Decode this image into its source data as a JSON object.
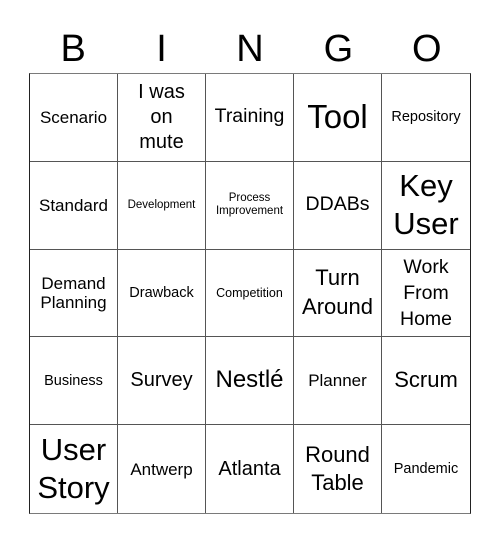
{
  "header": {
    "letters": [
      "B",
      "I",
      "N",
      "G",
      "O"
    ]
  },
  "cells": [
    "Scenario",
    "I was on mute",
    "Training",
    "Tool",
    "Repository",
    "Standard",
    "Development",
    "Process Improvement",
    "DDABs",
    "Key User",
    "Demand Planning",
    "Drawback",
    "Competition",
    "Turn Around",
    "Work From Home",
    "Business",
    "Survey",
    "Nestlé",
    "Planner",
    "Scrum",
    "User Story",
    "Antwerp",
    "Atlanta",
    "Round Table",
    "Pandemic"
  ]
}
